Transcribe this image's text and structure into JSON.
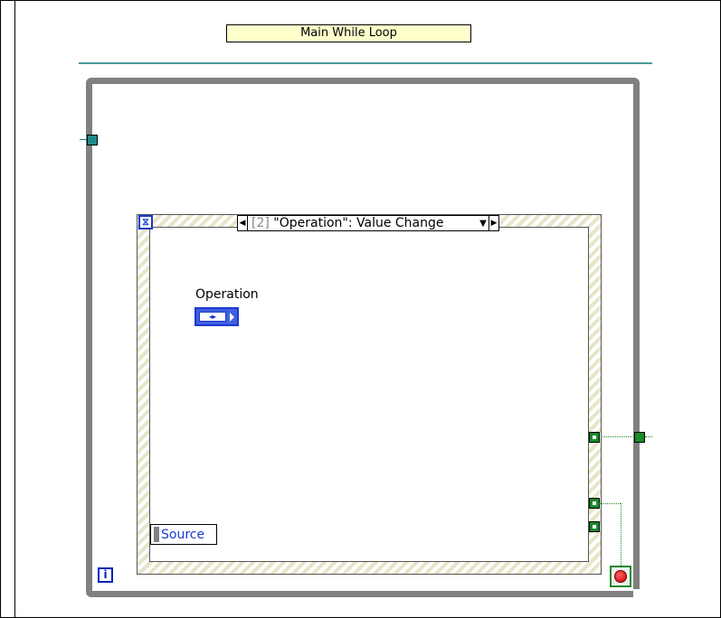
{
  "diagram": {
    "loop_label": "Main While Loop",
    "event_case": {
      "index": "[2]",
      "name": "\"Operation\": Value Change",
      "prev_arrow": "◀",
      "next_arrow": "▶",
      "dropdown_arrow": "▼"
    },
    "control": {
      "label": "Operation",
      "glyph": "◂▸"
    },
    "event_data_node": {
      "label": "Source"
    },
    "iteration_terminal": "i",
    "timeout_icon": "⧖"
  },
  "colors": {
    "loop_frame": "#808080",
    "label_background": "#ffffcc",
    "teal_wire": "#1f8a8a",
    "boolean_wire": "#1a8a2a",
    "terminal_blue": "#1a3ad0",
    "stop_red": "#d00000"
  }
}
